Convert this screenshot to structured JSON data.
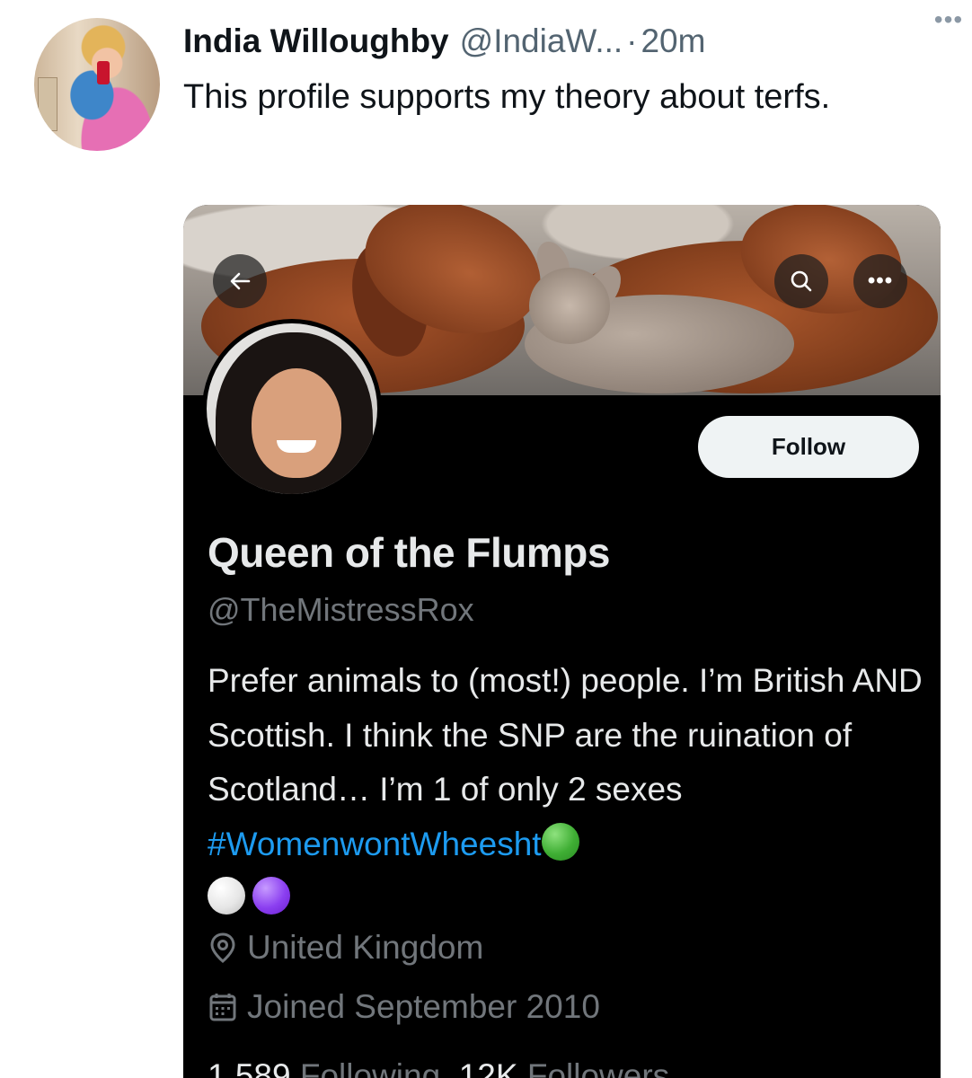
{
  "tweet": {
    "author_name": "India Willoughby",
    "author_handle": "@IndiaW...",
    "separator": "·",
    "time": "20m",
    "text": "This profile supports my theory about terfs."
  },
  "profile": {
    "follow_label": "Follow",
    "display_name": "Queen of the Flumps",
    "handle": "@TheMistressRox",
    "bio_text": "Prefer animals to (most!) people. I’m British AND Scottish. I think the SNP are the ruination of Scotland… I’m 1 of only 2 sexes ",
    "bio_hashtag": "#WomenwontWheesht",
    "bio_emojis": [
      "green-circle",
      "white-circle",
      "purple-circle"
    ],
    "location": "United Kingdom",
    "joined": "Joined September 2010",
    "following_count": "1,589",
    "following_label": "Following",
    "followers_count": "12K",
    "followers_label": "Followers"
  },
  "colors": {
    "hashtag": "#1d9bf0",
    "card_background": "#000000",
    "secondary_text": "#71767b"
  },
  "icons": [
    "more-horizontal-icon",
    "back-arrow-icon",
    "search-icon",
    "more-icon",
    "location-pin-icon",
    "calendar-icon"
  ]
}
